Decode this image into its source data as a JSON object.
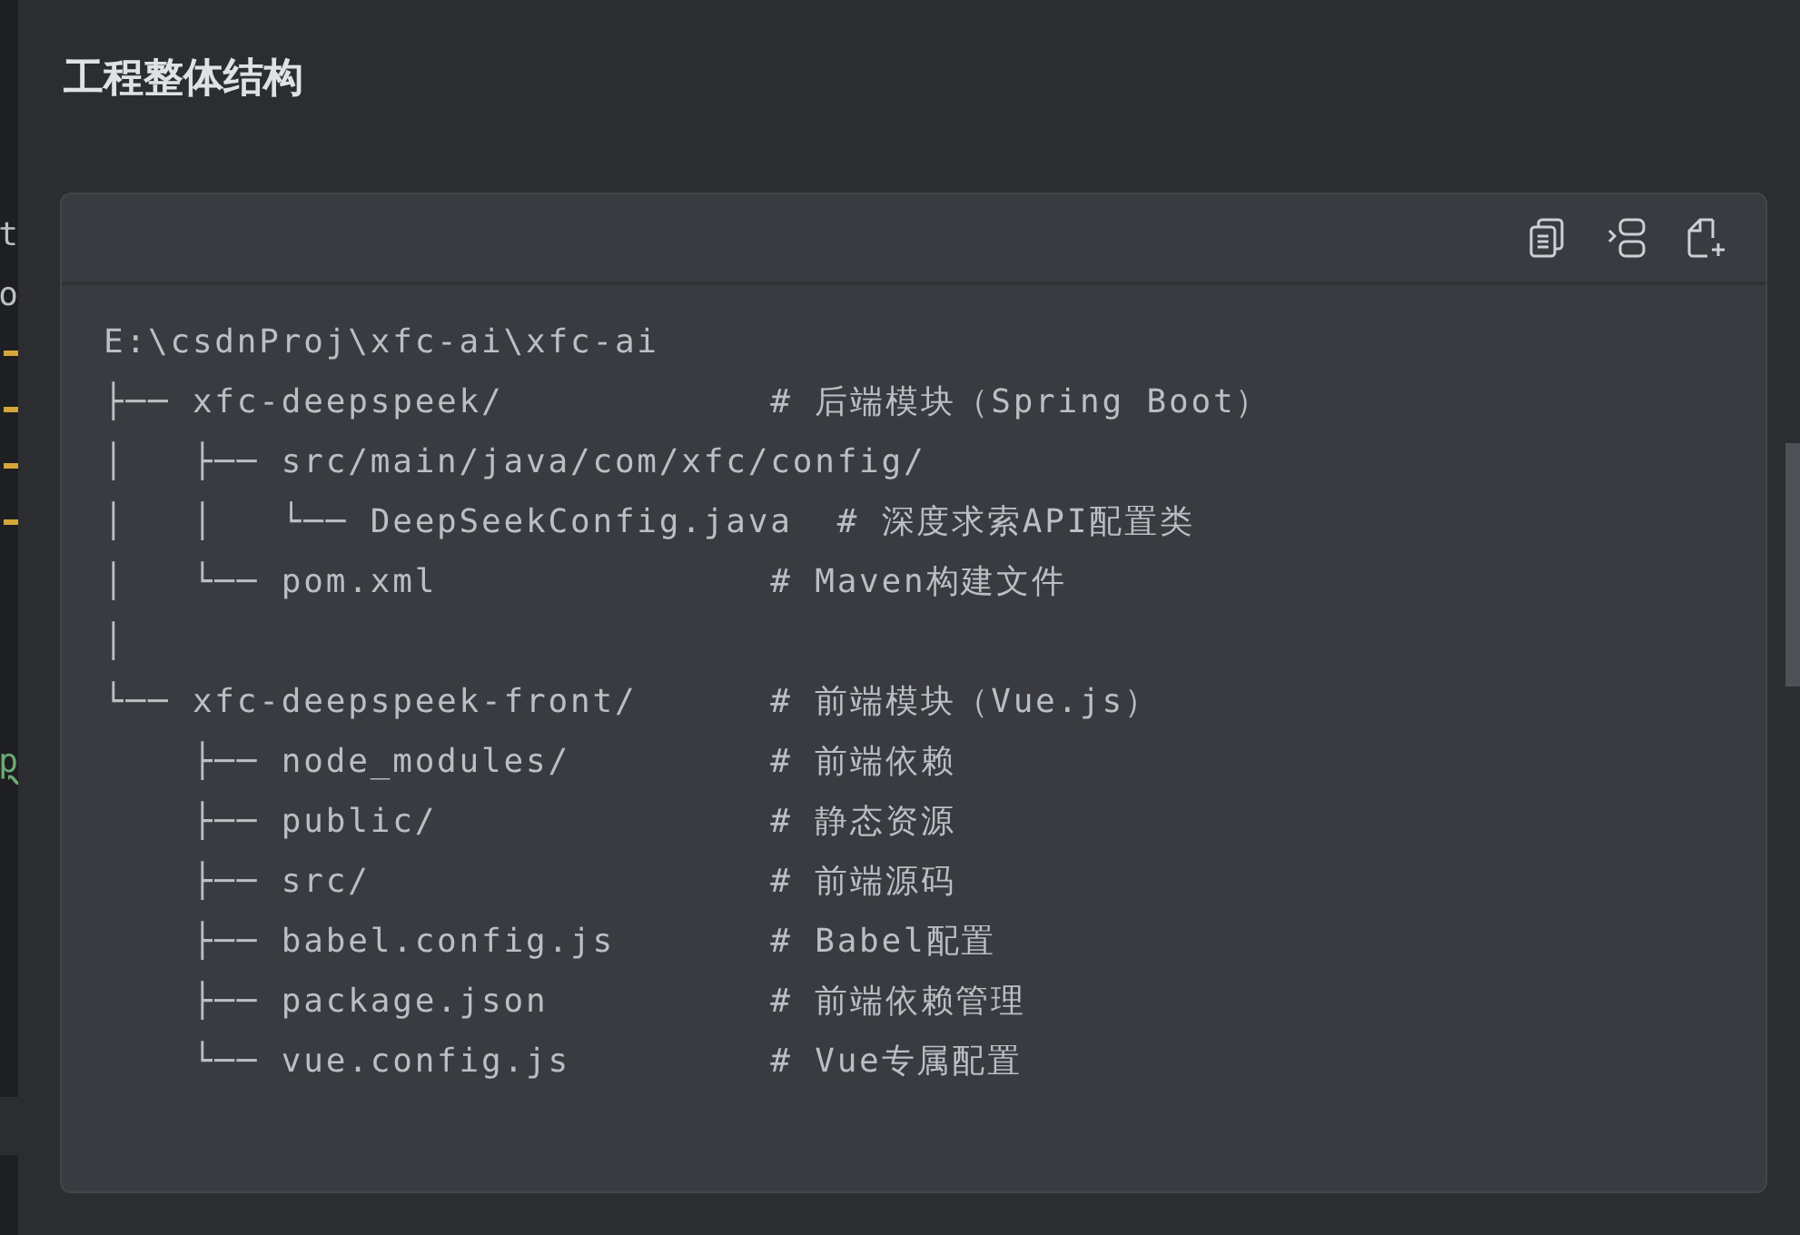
{
  "side_editor": {
    "lines": [
      {
        "kind": "text",
        "text": "t"
      },
      {
        "kind": "text",
        "text": "o"
      },
      {
        "kind": "marker"
      },
      {
        "kind": "marker"
      },
      {
        "kind": "marker"
      },
      {
        "kind": "marker"
      },
      {
        "kind": "warning",
        "text": "p"
      }
    ]
  },
  "heading": "工程整体结构",
  "code_block": {
    "lines": [
      "E:\\csdnProj\\xfc-ai\\xfc-ai",
      "├── xfc-deepspeek/            # 后端模块（Spring Boot）",
      "│   ├── src/main/java/com/xfc/config/",
      "│   │   └── DeepSeekConfig.java  # 深度求索API配置类",
      "│   └── pom.xml               # Maven构建文件",
      "│",
      "└── xfc-deepspeek-front/      # 前端模块（Vue.js）",
      "    ├── node_modules/         # 前端依赖",
      "    ├── public/               # 静态资源",
      "    ├── src/                  # 前端源码",
      "    ├── babel.config.js       # Babel配置",
      "    ├── package.json          # 前端依赖管理",
      "    └── vue.config.js         # Vue专属配置"
    ]
  }
}
